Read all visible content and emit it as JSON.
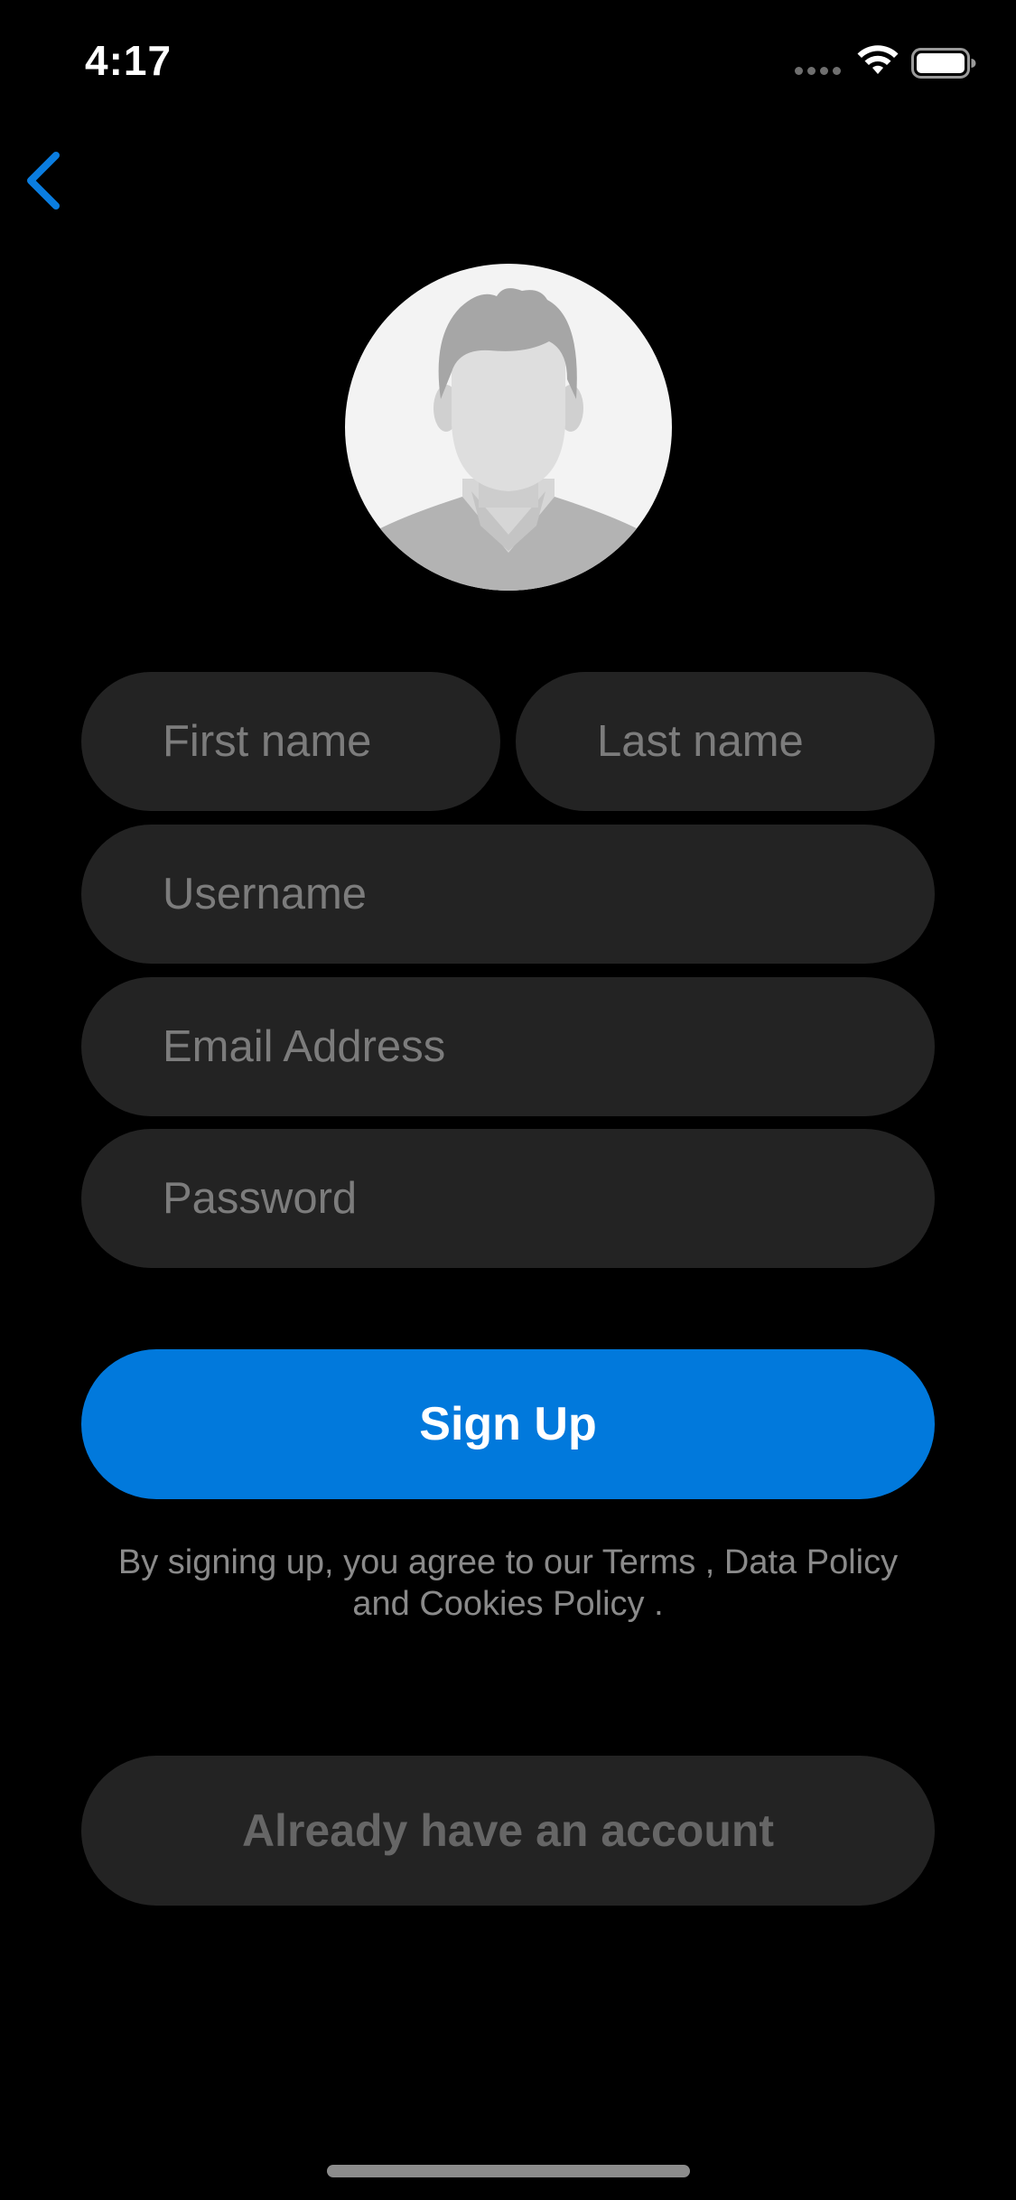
{
  "status_bar": {
    "time": "4:17",
    "signal_icon": "cellular-signal-icon",
    "wifi_icon": "wifi-icon",
    "battery_icon": "battery-icon"
  },
  "nav": {
    "back_icon": "chevron-left-icon"
  },
  "avatar": {
    "icon": "default-profile-avatar-icon"
  },
  "form": {
    "first_name": {
      "placeholder": "First name",
      "value": ""
    },
    "last_name": {
      "placeholder": "Last name",
      "value": ""
    },
    "username": {
      "placeholder": "Username",
      "value": ""
    },
    "email": {
      "placeholder": "Email Address",
      "value": ""
    },
    "password": {
      "placeholder": "Password",
      "value": ""
    }
  },
  "signup_button": {
    "label": "Sign Up"
  },
  "terms": {
    "prefix": "By signing up, you agree to our",
    "terms_link": "Terms",
    "separator": ",",
    "data_policy_link": "Data Policy",
    "conjunction": "and",
    "cookies_link": "Cookies Policy",
    "suffix": "."
  },
  "login_button": {
    "label": "Already have an account"
  },
  "colors": {
    "background": "#000000",
    "field_background": "#232323",
    "placeholder": "#7c7c7c",
    "accent": "#0179dc",
    "secondary_text": "#8a8a8a",
    "disabled_text": "#666666"
  }
}
